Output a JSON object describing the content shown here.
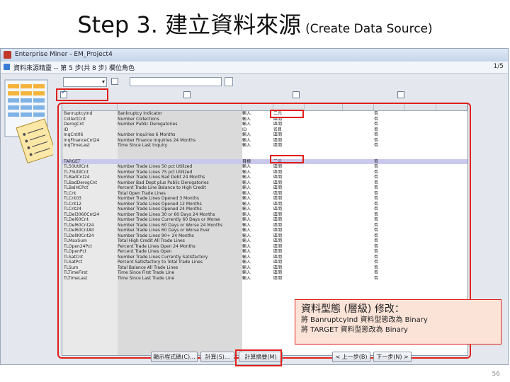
{
  "slide": {
    "title_main": "Step 3. 建立資料來源",
    "title_sub": "(Create Data Source)",
    "page_number": "56"
  },
  "app": {
    "title": "Enterprise Miner - EM_Project4"
  },
  "wizard": {
    "title": "資料來源精靈 -- 第 5 步(共 8 步)  欄位角色",
    "page_number": "1/5"
  },
  "grid": {
    "highlighted_row_index": 9,
    "rows": [
      {
        "name": "BanruptcyInd",
        "label": "Bankruptcy Indicator",
        "role": "輸入",
        "level": "二元",
        "drop": "否"
      },
      {
        "name": "CollectCnt",
        "label": "Number Collections",
        "role": "輸入",
        "level": "區間",
        "drop": "否"
      },
      {
        "name": "DerogCnt",
        "label": "Number Public Derogatories",
        "role": "輸入",
        "level": "區間",
        "drop": "否"
      },
      {
        "name": "ID",
        "label": "",
        "role": "ID",
        "level": "名目",
        "drop": "否"
      },
      {
        "name": "InqCnt06",
        "label": "Number Inquiries 6 Months",
        "role": "輸入",
        "level": "區間",
        "drop": "否"
      },
      {
        "name": "InqFinanceCnt24",
        "label": "Number Finance Inquiries 24 Months",
        "role": "輸入",
        "level": "區間",
        "drop": "否"
      },
      {
        "name": "InqTimeLast",
        "label": "Time Since Last Inquiry",
        "role": "輸入",
        "level": "區間",
        "drop": "否"
      },
      {
        "name": "",
        "label": "",
        "role": "",
        "level": "",
        "drop": ""
      },
      {
        "name": "",
        "label": "",
        "role": "",
        "level": "",
        "drop": ""
      },
      {
        "name": "TARGET",
        "label": "",
        "role": "目標",
        "level": "二元",
        "drop": "否"
      },
      {
        "name": "TL50UtilCnt",
        "label": "Number Trade Lines 50 pct Utilized",
        "role": "輸入",
        "level": "區間",
        "drop": "否"
      },
      {
        "name": "TL75UtilCnt",
        "label": "Number Trade Lines 75 pct Utilized",
        "role": "輸入",
        "level": "區間",
        "drop": "否"
      },
      {
        "name": "TLBadCnt24",
        "label": "Number Trade Lines Bad Debt 24 Months",
        "role": "輸入",
        "level": "區間",
        "drop": "否"
      },
      {
        "name": "TLBadDerogCnt",
        "label": "Number Bad Dept plus Public Derogatories",
        "role": "輸入",
        "level": "區間",
        "drop": "否"
      },
      {
        "name": "TLBalHCPct",
        "label": "Percent Trade Line Balance to High Credit",
        "role": "輸入",
        "level": "區間",
        "drop": "否"
      },
      {
        "name": "TLCnt",
        "label": "Total Open Trade Lines",
        "role": "輸入",
        "level": "區間",
        "drop": "否"
      },
      {
        "name": "TLCnt03",
        "label": "Number Trade Lines Opened 3 Months",
        "role": "輸入",
        "level": "區間",
        "drop": "否"
      },
      {
        "name": "TLCnt12",
        "label": "Number Trade Lines Opened 12 Months",
        "role": "輸入",
        "level": "區間",
        "drop": "否"
      },
      {
        "name": "TLCnt24",
        "label": "Number Trade Lines Opened 24 Months",
        "role": "輸入",
        "level": "區間",
        "drop": "否"
      },
      {
        "name": "TLDel3060Cnt24",
        "label": "Number Trade Lines 30 or 60 Days 24 Months",
        "role": "輸入",
        "level": "區間",
        "drop": "否"
      },
      {
        "name": "TLDel60Cnt",
        "label": "Number Trade Lines Currently 60 Days or Worse",
        "role": "輸入",
        "level": "區間",
        "drop": "否"
      },
      {
        "name": "TLDel60Cnt24",
        "label": "Number Trade Lines 60 Days or Worse 24 Months",
        "role": "輸入",
        "level": "區間",
        "drop": "否"
      },
      {
        "name": "TLDel60CntAll",
        "label": "Number Trade Lines 60 Days or Worse Ever",
        "role": "輸入",
        "level": "區間",
        "drop": "否"
      },
      {
        "name": "TLDel90Cnt24",
        "label": "Number Trade Lines 90+ 24 Months",
        "role": "輸入",
        "level": "區間",
        "drop": "否"
      },
      {
        "name": "TLMaxSum",
        "label": "Total High Credit All Trade Lines",
        "role": "輸入",
        "level": "區間",
        "drop": "否"
      },
      {
        "name": "TLOpen24Pct",
        "label": "Percent Trade Lines Open 24 Months",
        "role": "輸入",
        "level": "區間",
        "drop": "否"
      },
      {
        "name": "TLOpenPct",
        "label": "Percent Trade Lines Open",
        "role": "輸入",
        "level": "區間",
        "drop": "否"
      },
      {
        "name": "TLSatCnt",
        "label": "Number Trade Lines Currently Satisfactory",
        "role": "輸入",
        "level": "區間",
        "drop": "否"
      },
      {
        "name": "TLSatPct",
        "label": "Percent Satisfactory to Total Trade Lines",
        "role": "輸入",
        "level": "區間",
        "drop": "否"
      },
      {
        "name": "TLSum",
        "label": "Total Balance All Trade Lines",
        "role": "輸入",
        "level": "區間",
        "drop": "否"
      },
      {
        "name": "TLTimeFirst",
        "label": "Time Since First Trade Line",
        "role": "輸入",
        "level": "區間",
        "drop": "否"
      },
      {
        "name": "TLTimeLast",
        "label": "Time Since Last Trade Line",
        "role": "輸入",
        "level": "區間",
        "drop": "否"
      }
    ]
  },
  "buttons": {
    "show_code": "顯示程式碼(C)...",
    "compute": "計算(S)...",
    "statistics": "計算摘要(M)",
    "back": "< 上一步(B)",
    "next": "下一步(N) >"
  },
  "callout": {
    "title": "資料型態 (層級) 修改：",
    "line1": "將 BanruptcyInd 資料型態改為 Binary",
    "line2": "將 TARGET 資料型態改為 Binary"
  }
}
